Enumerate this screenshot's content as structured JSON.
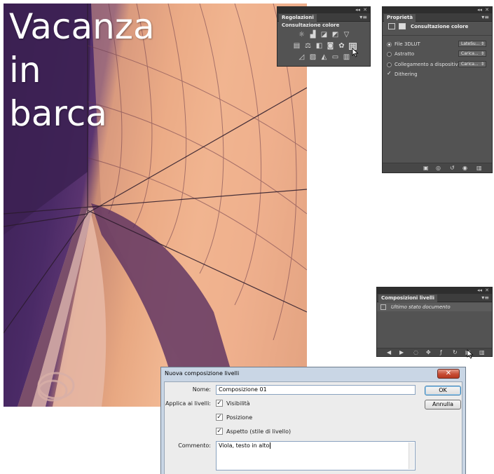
{
  "photo": {
    "title_lines": [
      "Vacanza",
      "in",
      "barca"
    ]
  },
  "adjustments_panel": {
    "tab": "Regolazioni",
    "heading": "Consultazione colore",
    "collapse": "◂◂",
    "close": "✕",
    "menu": "▾≡",
    "icons_row1": [
      "brightness-icon",
      "levels-icon",
      "curves-icon",
      "exposure-icon",
      "vibrance-icon"
    ],
    "icons_row2": [
      "hue-saturation-icon",
      "color-balance-icon",
      "black-white-icon",
      "photo-filter-icon",
      "channel-mixer-icon",
      "color-lookup-icon"
    ],
    "icons_row3": [
      "invert-icon",
      "posterize-icon",
      "threshold-icon",
      "gradient-map-icon",
      "selective-color-icon"
    ]
  },
  "properties_panel": {
    "tab": "Proprietà",
    "collapse": "◂◂",
    "close": "✕",
    "menu": "▾≡",
    "header_title": "Consultazione colore",
    "options": [
      {
        "label": "File 3DLUT",
        "selected": true,
        "dropdown": "LateSu..."
      },
      {
        "label": "Astratto",
        "selected": false,
        "dropdown": "Carica..."
      },
      {
        "label": "Collegamento a dispositivo",
        "selected": false,
        "dropdown": "Carica..."
      }
    ],
    "dithering_label": "Dithering",
    "dithering_checked": true
  },
  "layer_comps_panel": {
    "tab": "Composizioni livelli",
    "collapse": "◂◂",
    "close": "✕",
    "menu": "▾≡",
    "row_label": "Ultimo stato documento"
  },
  "dialog": {
    "title": "Nuova composizione livelli",
    "close_glyph": "✕",
    "name_label": "Nome:",
    "name_value": "Composizione 01",
    "apply_label": "Applica ai livelli:",
    "options": [
      {
        "label": "Visibilità",
        "checked": true
      },
      {
        "label": "Posizione",
        "checked": true
      },
      {
        "label": "Aspetto (stile di livello)",
        "checked": true
      }
    ],
    "comment_label": "Commento:",
    "comment_value": "Viola, testo in alto",
    "ok_label": "OK",
    "cancel_label": "Annulla"
  },
  "colors": {
    "panel_bg": "#535353",
    "dialog_frame": "#c9d6e5",
    "close_button": "#c84c34"
  }
}
